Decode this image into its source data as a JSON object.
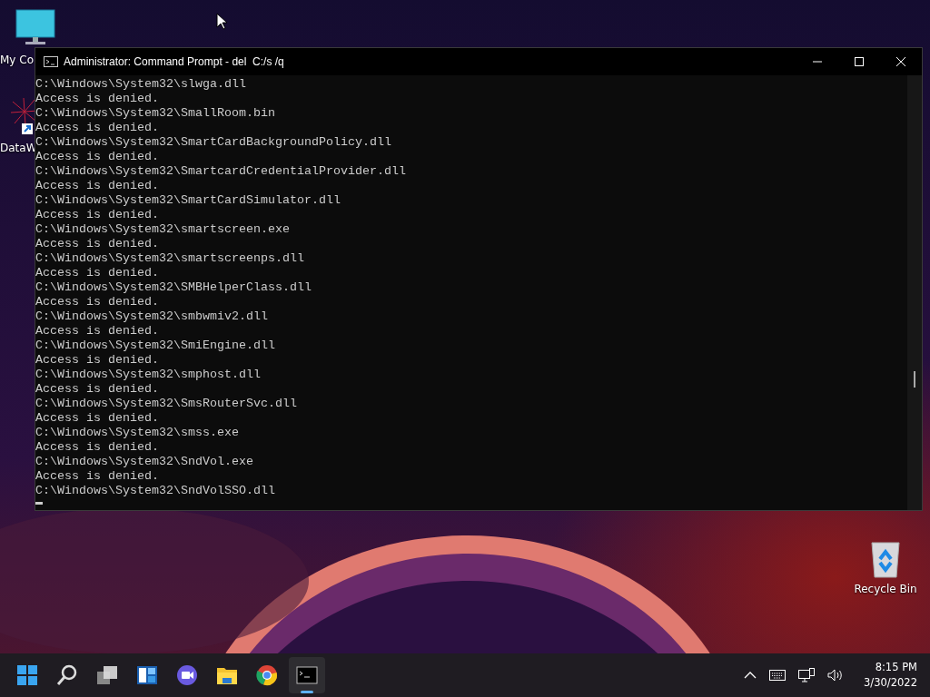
{
  "desktop_icons": [
    {
      "label": "My Co",
      "kind": "computer"
    },
    {
      "label": "DataW",
      "kind": "shortcut"
    },
    {
      "label": "Recycle Bin",
      "kind": "recycle"
    }
  ],
  "window": {
    "title": "Administrator: Command Prompt - del  C:/s /q",
    "lines": [
      "C:\\Windows\\System32\\slwga.dll",
      "Access is denied.",
      "C:\\Windows\\System32\\SmallRoom.bin",
      "Access is denied.",
      "C:\\Windows\\System32\\SmartCardBackgroundPolicy.dll",
      "Access is denied.",
      "C:\\Windows\\System32\\SmartcardCredentialProvider.dll",
      "Access is denied.",
      "C:\\Windows\\System32\\SmartCardSimulator.dll",
      "Access is denied.",
      "C:\\Windows\\System32\\smartscreen.exe",
      "Access is denied.",
      "C:\\Windows\\System32\\smartscreenps.dll",
      "Access is denied.",
      "C:\\Windows\\System32\\SMBHelperClass.dll",
      "Access is denied.",
      "C:\\Windows\\System32\\smbwmiv2.dll",
      "Access is denied.",
      "C:\\Windows\\System32\\SmiEngine.dll",
      "Access is denied.",
      "C:\\Windows\\System32\\smphost.dll",
      "Access is denied.",
      "C:\\Windows\\System32\\SmsRouterSvc.dll",
      "Access is denied.",
      "C:\\Windows\\System32\\smss.exe",
      "Access is denied.",
      "C:\\Windows\\System32\\SndVol.exe",
      "Access is denied.",
      "C:\\Windows\\System32\\SndVolSSO.dll"
    ]
  },
  "taskbar": {
    "items": [
      {
        "kind": "start",
        "selected": false
      },
      {
        "kind": "search",
        "selected": false
      },
      {
        "kind": "taskview",
        "selected": false
      },
      {
        "kind": "widgets",
        "selected": false
      },
      {
        "kind": "chat",
        "selected": false
      },
      {
        "kind": "explorer",
        "selected": false
      },
      {
        "kind": "chrome",
        "selected": false
      },
      {
        "kind": "terminal",
        "selected": true
      }
    ],
    "time": "8:15 PM",
    "date": "3/30/2022"
  }
}
